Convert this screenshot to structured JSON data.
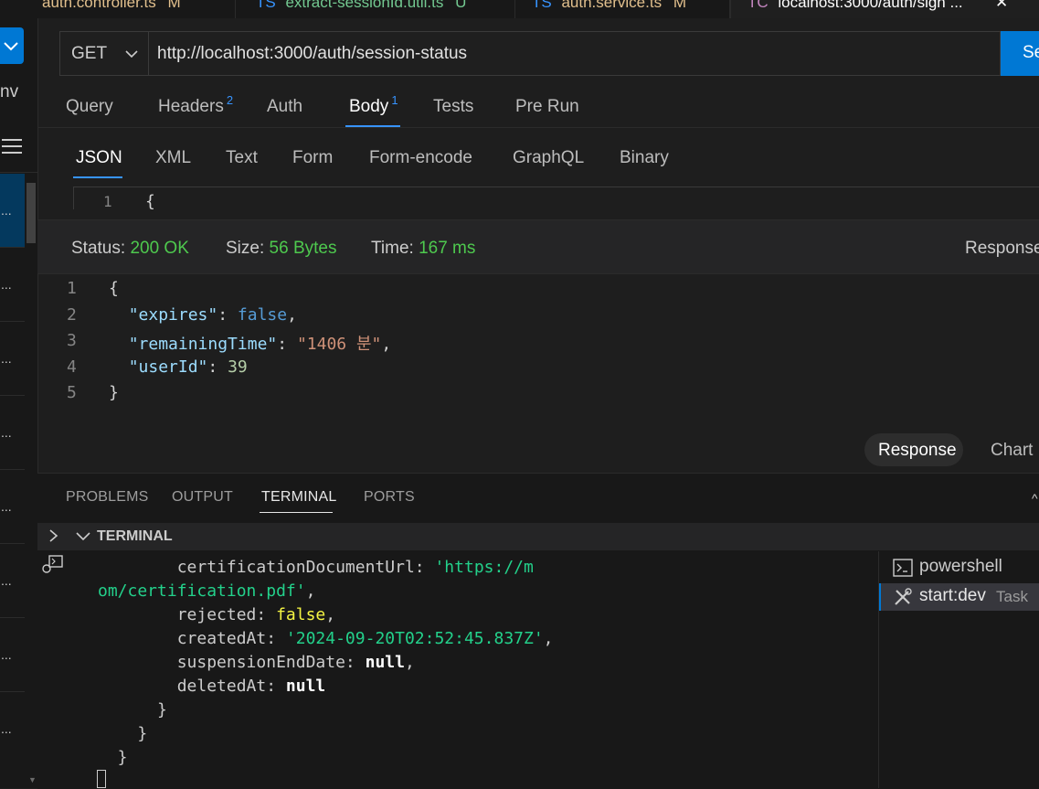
{
  "editor_tabs": [
    {
      "label": "auth.controller.ts",
      "status": "M"
    },
    {
      "label": "extract-sessionId.util.ts",
      "status": "U"
    },
    {
      "label": "auth.service.ts",
      "status": "M"
    },
    {
      "label": "localhost:3000/auth/sign ..."
    }
  ],
  "sidebar": {
    "title_fragment": "nv",
    "env_ellipsis": "..."
  },
  "request": {
    "method": "GET",
    "url": "http://localhost:3000/auth/session-status",
    "send_label": "Se"
  },
  "request_tabs": [
    {
      "label": "Query"
    },
    {
      "label": "Headers",
      "badge": "2"
    },
    {
      "label": "Auth"
    },
    {
      "label": "Body",
      "badge": "1"
    },
    {
      "label": "Tests"
    },
    {
      "label": "Pre Run"
    }
  ],
  "body_tabs": [
    "JSON",
    "XML",
    "Text",
    "Form",
    "Form-encode",
    "GraphQL",
    "Binary"
  ],
  "body_editor": {
    "line": "1",
    "text": "{"
  },
  "status": {
    "status_label": "Status:",
    "status_value": "200 OK",
    "size_label": "Size:",
    "size_value": "56 Bytes",
    "time_label": "Time:",
    "time_value": "167 ms",
    "right_label": "Response"
  },
  "response_lines": [
    {
      "n": "1",
      "parts": [
        {
          "t": "{",
          "c": "punc"
        }
      ]
    },
    {
      "n": "2",
      "parts": [
        {
          "t": "  ",
          "c": "punc"
        },
        {
          "t": "\"expires\"",
          "c": "key"
        },
        {
          "t": ": ",
          "c": "punc"
        },
        {
          "t": "false",
          "c": "bool"
        },
        {
          "t": ",",
          "c": "punc"
        }
      ]
    },
    {
      "n": "3",
      "parts": [
        {
          "t": "  ",
          "c": "punc"
        },
        {
          "t": "\"remainingTime\"",
          "c": "key"
        },
        {
          "t": ": ",
          "c": "punc"
        },
        {
          "t": "\"1406 분\"",
          "c": "str"
        },
        {
          "t": ",",
          "c": "punc"
        }
      ]
    },
    {
      "n": "4",
      "parts": [
        {
          "t": "  ",
          "c": "punc"
        },
        {
          "t": "\"userId\"",
          "c": "key"
        },
        {
          "t": ": ",
          "c": "punc"
        },
        {
          "t": "39",
          "c": "num"
        }
      ]
    },
    {
      "n": "5",
      "parts": [
        {
          "t": "}",
          "c": "punc"
        }
      ]
    }
  ],
  "response_views": {
    "response": "Response",
    "chart": "Chart"
  },
  "panel_tabs": [
    "PROBLEMS",
    "OUTPUT",
    "TERMINAL",
    "PORTS"
  ],
  "terminal_header": "TERMINAL",
  "terminal_lines": [
    [
      {
        "t": "        certificationDocumentUrl: ",
        "c": "plain"
      },
      {
        "t": "'https://m",
        "c": "green"
      }
    ],
    [
      {
        "t": "om/certification.pdf",
        "c": "green"
      },
      {
        "t": "'",
        "c": "green"
      },
      {
        "t": ",",
        "c": "plain"
      }
    ],
    [
      {
        "t": "        rejected: ",
        "c": "plain"
      },
      {
        "t": "false",
        "c": "yellow"
      },
      {
        "t": ",",
        "c": "plain"
      }
    ],
    [
      {
        "t": "        createdAt: ",
        "c": "plain"
      },
      {
        "t": "'2024-09-20T02:52:45.837Z'",
        "c": "green"
      },
      {
        "t": ",",
        "c": "plain"
      }
    ],
    [
      {
        "t": "        suspensionEndDate: ",
        "c": "plain"
      },
      {
        "t": "null",
        "c": "bold"
      },
      {
        "t": ",",
        "c": "plain"
      }
    ],
    [
      {
        "t": "        deletedAt: ",
        "c": "plain"
      },
      {
        "t": "null",
        "c": "bold"
      }
    ],
    [
      {
        "t": "      }",
        "c": "plain"
      }
    ],
    [
      {
        "t": "    }",
        "c": "plain"
      }
    ],
    [
      {
        "t": "  }",
        "c": "plain"
      }
    ]
  ],
  "terminal_list": [
    {
      "name": "powershell",
      "icon": "terminal-icon"
    },
    {
      "name": "start:dev",
      "suffix": "Task",
      "icon": "tools-icon"
    }
  ],
  "colors": {
    "key": "#9cdcfe",
    "bool": "#569cd6",
    "str": "#ce9178",
    "num": "#b5cea8",
    "status_green": "#4ec94e",
    "term_green": "#23d18b",
    "term_yellow": "#f5f543",
    "accent": "#3794ff"
  }
}
